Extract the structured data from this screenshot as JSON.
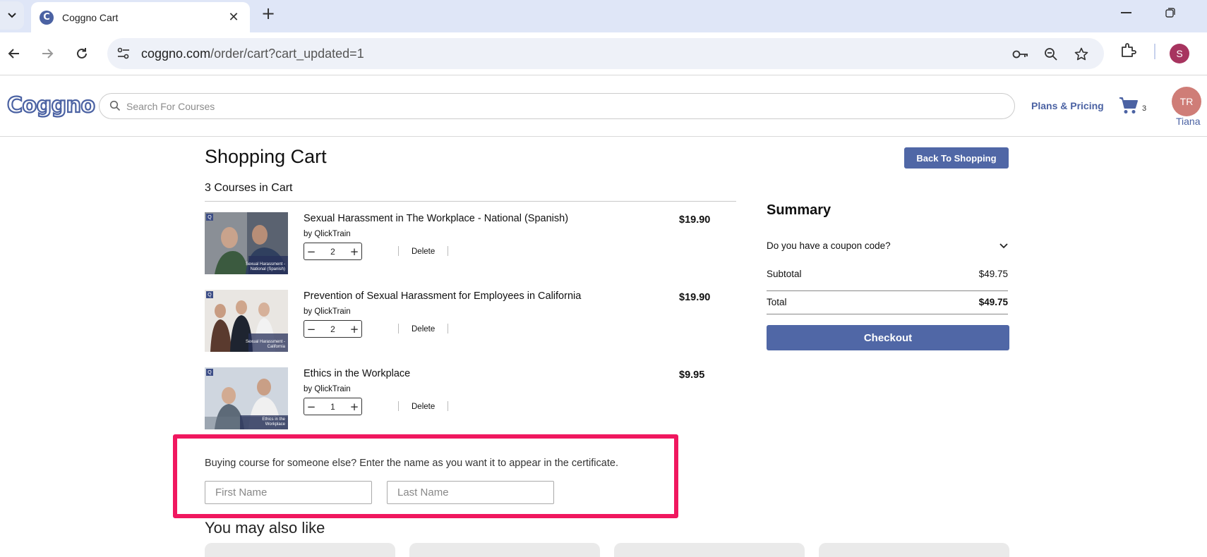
{
  "browser": {
    "tab_title": "Coggno Cart",
    "favicon_letter": "C",
    "url_host": "coggno.com",
    "url_path": "/order/cart?cart_updated=1",
    "profile_initial": "S"
  },
  "header": {
    "logo": "Coggno",
    "search_placeholder": "Search For Courses",
    "plans_link": "Plans & Pricing",
    "cart_count": "3",
    "avatar_initials": "TR",
    "user_name": "Tiana"
  },
  "cart": {
    "title": "Shopping Cart",
    "back_button": "Back To Shopping",
    "count_text": "3 Courses in Cart",
    "delete_label": "Delete",
    "items": [
      {
        "title": "Sexual Harassment in The Workplace - National (Spanish)",
        "by": "by QlickTrain",
        "qty": "2",
        "price": "$19.90",
        "thumb_caption": "Sexual Harassment - National (Spanish)"
      },
      {
        "title": "Prevention of Sexual Harassment for Employees in California",
        "by": "by QlickTrain",
        "qty": "2",
        "price": "$19.90",
        "thumb_caption": "Sexual Harassment - California"
      },
      {
        "title": "Ethics in the Workplace",
        "by": "by QlickTrain",
        "qty": "1",
        "price": "$9.95",
        "thumb_caption": "Ethics in the Workplace"
      }
    ]
  },
  "summary": {
    "title": "Summary",
    "coupon_text": "Do you have a coupon code?",
    "subtotal_label": "Subtotal",
    "subtotal_value": "$49.75",
    "total_label": "Total",
    "total_value": "$49.75",
    "checkout_button": "Checkout"
  },
  "recipient": {
    "prompt": "Buying course for someone else? Enter the name as you want it to appear in the certificate.",
    "first_name_placeholder": "First Name",
    "last_name_placeholder": "Last Name"
  },
  "recommendations": {
    "title": "You may also like"
  },
  "colors": {
    "brand": "#4b62a3",
    "button": "#5067a6",
    "highlight": "#f0175f"
  }
}
